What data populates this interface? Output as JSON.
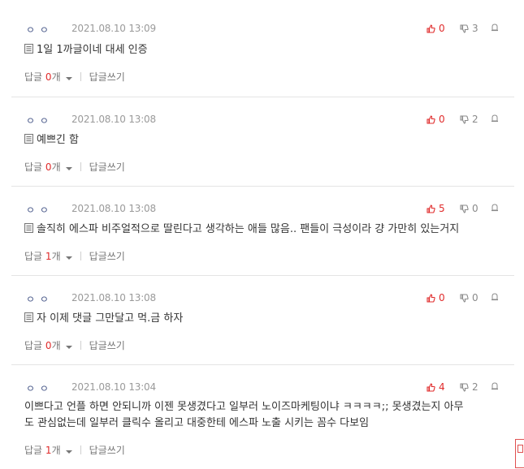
{
  "comments": [
    {
      "nick": "ㅇ ㅇ",
      "date": "2021.08.10 13:09",
      "up": "0",
      "down": "3",
      "has_doc_icon": true,
      "text": "1일 1까글이네 대세 인증",
      "reply_label": "답글",
      "reply_count": "0",
      "reply_unit": "개",
      "write_label": "답글쓰기"
    },
    {
      "nick": "ㅇ ㅇ",
      "date": "2021.08.10 13:08",
      "up": "0",
      "down": "2",
      "has_doc_icon": true,
      "text": "예쁘긴 함",
      "reply_label": "답글",
      "reply_count": "0",
      "reply_unit": "개",
      "write_label": "답글쓰기"
    },
    {
      "nick": "ㅇ ㅇ",
      "date": "2021.08.10 13:08",
      "up": "5",
      "down": "0",
      "has_doc_icon": true,
      "text": "솔직히 에스파 비주얼적으로 딸린다고 생각하는 애들 많음.. 팬들이 극성이라 걍 가만히 있는거지",
      "reply_label": "답글",
      "reply_count": "1",
      "reply_unit": "개",
      "write_label": "답글쓰기"
    },
    {
      "nick": "ㅇ ㅇ",
      "date": "2021.08.10 13:08",
      "up": "0",
      "down": "0",
      "has_doc_icon": true,
      "text": "자 이제 댓글 그만달고 먹.금 하자",
      "reply_label": "답글",
      "reply_count": "0",
      "reply_unit": "개",
      "write_label": "답글쓰기"
    },
    {
      "nick": "ㅇ ㅇ",
      "date": "2021.08.10 13:04",
      "up": "4",
      "down": "2",
      "has_doc_icon": false,
      "text_line1": "이쁘다고 언플 하면 안되니까 이젠 못생겼다고 일부러 노이즈마케팅이냐 ㅋㅋㅋㅋ;; 못생겼는지 아무",
      "text_line2": "도 관심없는데 일부러 클릭수 올리고 대중한테 에스파 노출 시키는 꼼수 다보임",
      "reply_label": "답글",
      "reply_count": "1",
      "reply_unit": "개",
      "write_label": "답글쓰기"
    }
  ],
  "icons": {
    "up": "thumbs-up-icon",
    "down": "thumbs-down-icon",
    "report": "report-icon",
    "doc": "document-icon"
  },
  "colors": {
    "accent": "#e02b2b",
    "divider": "#e4e4e4"
  }
}
